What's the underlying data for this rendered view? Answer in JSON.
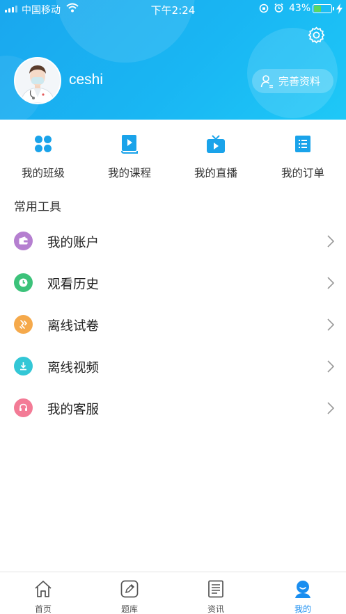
{
  "status_bar": {
    "carrier": "中国移动",
    "time": "下午2:24",
    "battery_percent": "43%",
    "battery_level": 0.43,
    "battery_color": "#5bd65f"
  },
  "profile": {
    "username": "ceshi",
    "complete_profile_label": "完善资料",
    "avatar_icon": "doctor-avatar",
    "settings_icon": "gear-icon"
  },
  "quick_actions": [
    {
      "label": "我的班级",
      "icon": "clover-icon",
      "color": "#1aa3ea"
    },
    {
      "label": "我的课程",
      "icon": "book-play-icon",
      "color": "#1aa3ea"
    },
    {
      "label": "我的直播",
      "icon": "tv-icon",
      "color": "#1aa3ea"
    },
    {
      "label": "我的订单",
      "icon": "list-icon",
      "color": "#1aa3ea"
    }
  ],
  "tools_section": {
    "title": "常用工具",
    "items": [
      {
        "label": "我的账户",
        "icon": "wallet-icon",
        "color": "#b57fd0"
      },
      {
        "label": "观看历史",
        "icon": "clock-icon",
        "color": "#3cc27a"
      },
      {
        "label": "离线试卷",
        "icon": "paper-offline-icon",
        "color": "#f5a94b"
      },
      {
        "label": "离线视频",
        "icon": "download-icon",
        "color": "#33c7d6"
      },
      {
        "label": "我的客服",
        "icon": "headset-icon",
        "color": "#f37b96"
      }
    ]
  },
  "tab_bar": {
    "tabs": [
      {
        "label": "首页",
        "icon": "home-icon",
        "active": false
      },
      {
        "label": "题库",
        "icon": "pencil-icon",
        "active": false
      },
      {
        "label": "资讯",
        "icon": "news-icon",
        "active": false
      },
      {
        "label": "我的",
        "icon": "profile-icon",
        "active": true
      }
    ],
    "active_color": "#1a8ef0"
  }
}
